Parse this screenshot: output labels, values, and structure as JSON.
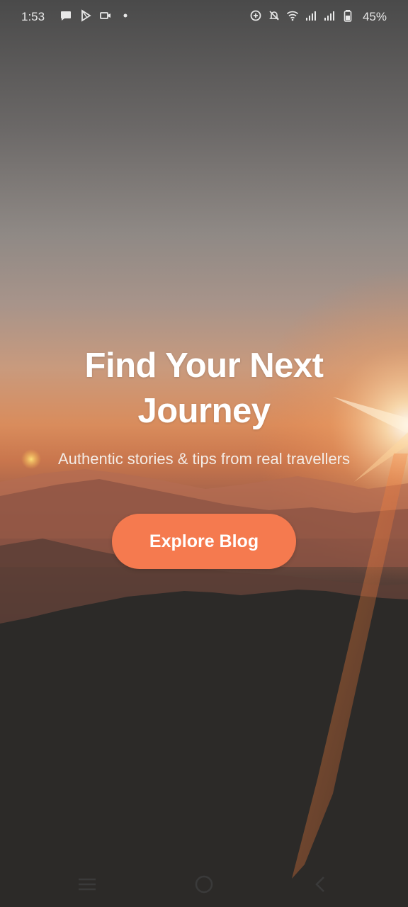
{
  "status_bar": {
    "time": "1:53",
    "battery_percent": "45%",
    "left_icons": [
      "chat-bubble-icon",
      "play-store-icon",
      "video-icon",
      "dot-icon"
    ],
    "right_icons": [
      "data-saver-icon",
      "muted-bell-icon",
      "wifi-icon",
      "signal-icon",
      "signal-icon",
      "battery-icon"
    ]
  },
  "hero": {
    "title": "Find Your Next Journey",
    "subtitle": "Authentic stories & tips from real travellers",
    "button_label": "Explore Blog"
  },
  "nav_bar": {
    "buttons": [
      "menu-icon",
      "home-icon",
      "back-icon"
    ]
  },
  "colors": {
    "accent": "#f57a4f",
    "text_primary": "#ffffff"
  }
}
